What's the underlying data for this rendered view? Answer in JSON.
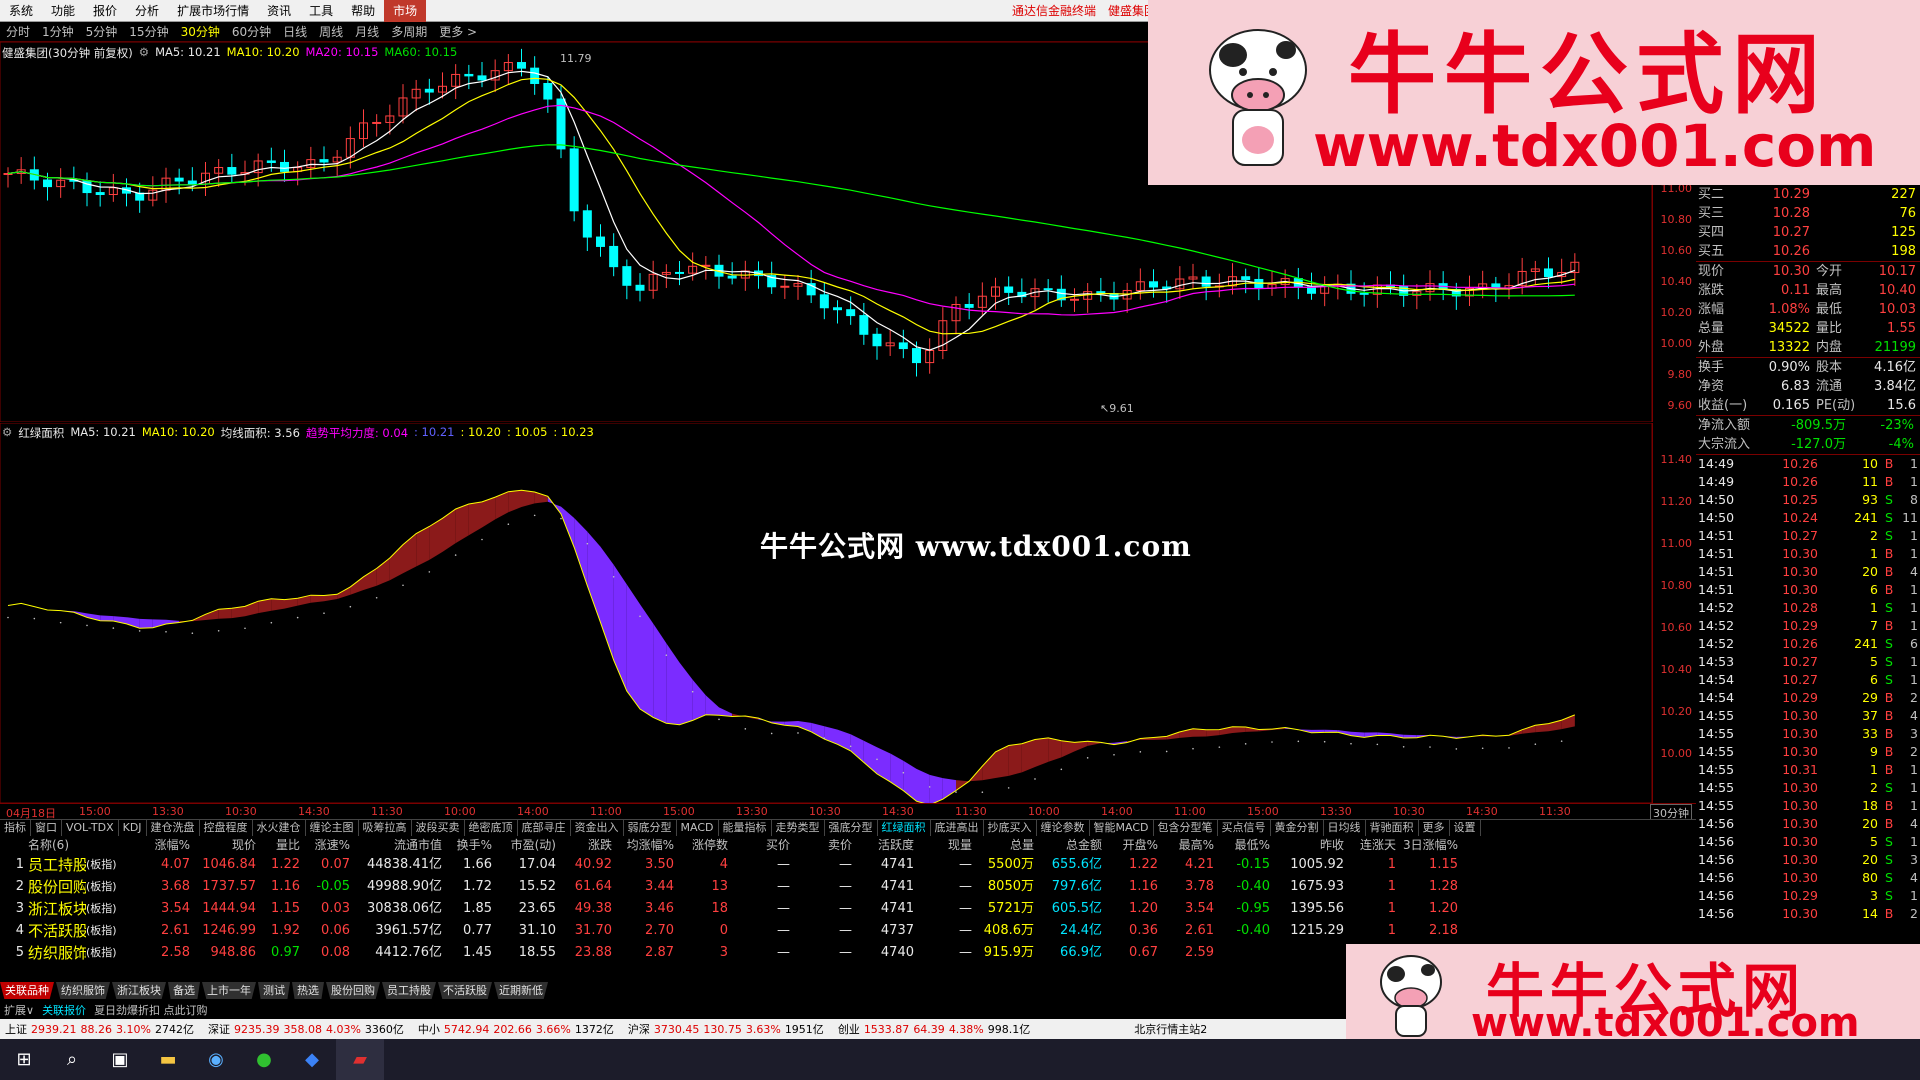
{
  "menu": [
    "系统",
    "功能",
    "报价",
    "分析",
    "扩展市场行情",
    "资讯",
    "工具",
    "帮助",
    "市场"
  ],
  "menu_links": [
    "通达信金融终端",
    "健盛集团"
  ],
  "periods": [
    "分时",
    "1分钟",
    "5分钟",
    "15分钟",
    "30分钟",
    "60分钟",
    "日线",
    "周线",
    "月线",
    "多周期",
    "更多 >"
  ],
  "legend_main": {
    "name": "健盛集团(30分钟 前复权)",
    "ma5": "MA5: 10.21",
    "ma10": "MA10: 10.20",
    "ma20": "MA20: 10.15",
    "ma60": "MA60: 10.15"
  },
  "legend_sub": {
    "name": "红绿面积",
    "ma5": "MA5: 10.21",
    "ma10": "MA10: 10.20",
    "jx": "均线面积: 3.56",
    "qs": "趋势平均力度: 0.04",
    "v1": ": 10.21",
    "v2": ": 10.20",
    "v3": ": 10.05",
    "v4": ": 10.23"
  },
  "price_annotations": {
    "high": "11.79",
    "low": "9.61"
  },
  "yaxis_main": [
    "11.00",
    "10.80",
    "10.60",
    "10.40",
    "10.20",
    "10.00",
    "9.80",
    "9.60"
  ],
  "yaxis_sub": [
    "11.40",
    "11.20",
    "11.00",
    "10.80",
    "10.60",
    "10.40",
    "10.20",
    "10.00"
  ],
  "time_labels": [
    "04月18日",
    "15:00",
    "13:30",
    "10:30",
    "14:30",
    "11:30",
    "10:00",
    "14:00",
    "11:00",
    "15:00",
    "13:30",
    "10:30",
    "14:30",
    "11:30",
    "10:00",
    "14:00",
    "11:00",
    "15:00",
    "13:30",
    "10:30",
    "14:30",
    "11:30"
  ],
  "time_select": "30分钟",
  "indicator_tabs": [
    "指标",
    "窗口",
    "VOL-TDX",
    "KDJ",
    "建仓洗盘",
    "控盘程度",
    "水火建仓",
    "缠论主图",
    "吸筹拉高",
    "波段买卖",
    "绝密底顶",
    "底部寻庄",
    "资金出入",
    "弱底分型",
    "MACD",
    "能量指标",
    "走势类型",
    "强底分型",
    "红绿面积",
    "底进高出",
    "抄底买入",
    "缠论参数",
    "智能MACD",
    "包含分型笔",
    "买点信号",
    "黄金分割",
    "日均线",
    "背驰面积",
    "更多",
    "设置"
  ],
  "selected_indicator": "红绿面积",
  "table": {
    "headers": [
      "",
      "名称(6)",
      "",
      "涨幅%",
      "现价",
      "量比",
      "涨速%",
      "流通市值",
      "换手%",
      "市盈(动)",
      "涨跌",
      "均涨幅%",
      "涨停数",
      "买价",
      "卖价",
      "活跃度",
      "现量",
      "总量",
      "总金额",
      "开盘%",
      "最高%",
      "最低%",
      "昨收",
      "连涨天",
      "3日涨幅%"
    ],
    "rows": [
      [
        "1",
        "员工持股",
        "(板指)",
        "4.07",
        "1046.84",
        "1.22",
        "0.07",
        "44838.41亿",
        "1.66",
        "17.04",
        "40.92",
        "3.50",
        "4",
        "—",
        "—",
        "4741",
        "—",
        "5500万",
        "655.6亿",
        "1.22",
        "4.21",
        "-0.15",
        "1005.92",
        "1",
        "1.15"
      ],
      [
        "2",
        "股份回购",
        "(板指)",
        "3.68",
        "1737.57",
        "1.16",
        "-0.05",
        "49988.90亿",
        "1.72",
        "15.52",
        "61.64",
        "3.44",
        "13",
        "—",
        "—",
        "4741",
        "—",
        "8050万",
        "797.6亿",
        "1.16",
        "3.78",
        "-0.40",
        "1675.93",
        "1",
        "1.28"
      ],
      [
        "3",
        "浙江板块",
        "(板指)",
        "3.54",
        "1444.94",
        "1.15",
        "0.03",
        "30838.06亿",
        "1.85",
        "23.65",
        "49.38",
        "3.46",
        "18",
        "—",
        "—",
        "4741",
        "—",
        "5721万",
        "605.5亿",
        "1.20",
        "3.54",
        "-0.95",
        "1395.56",
        "1",
        "1.20"
      ],
      [
        "4",
        "不活跃股",
        "(板指)",
        "2.61",
        "1246.99",
        "1.92",
        "0.06",
        "3961.57亿",
        "0.77",
        "31.10",
        "31.70",
        "2.70",
        "0",
        "—",
        "—",
        "4737",
        "—",
        "408.6万",
        "24.4亿",
        "0.36",
        "2.61",
        "-0.40",
        "1215.29",
        "1",
        "2.18"
      ],
      [
        "5",
        "纺织服饰",
        "(板指)",
        "2.58",
        "948.86",
        "0.97",
        "0.08",
        "4412.76亿",
        "1.45",
        "18.55",
        "23.88",
        "2.87",
        "3",
        "—",
        "—",
        "4740",
        "—",
        "915.9万",
        "66.9亿",
        "0.67",
        "2.59",
        "",
        "",
        "",
        ""
      ]
    ]
  },
  "block_tabs": [
    "关联品种",
    "纺织服饰",
    "浙江板块",
    "备选",
    "上市一年",
    "测试",
    "热选",
    "股份回购",
    "员工持股",
    "不活跃股",
    "近期新低"
  ],
  "ext_bar": [
    "扩展∨",
    "关联报价",
    "夏日劲爆折扣 点此订购"
  ],
  "status": [
    {
      "label": "上证",
      "v": "2939.21",
      "c": "88.26",
      "p": "3.10%",
      "a": "2742亿"
    },
    {
      "label": "深证",
      "v": "9235.39",
      "c": "358.08",
      "p": "4.03%",
      "a": "3360亿"
    },
    {
      "label": "中小",
      "v": "5742.94",
      "c": "202.66",
      "p": "3.66%",
      "a": "1372亿"
    },
    {
      "label": "沪深",
      "v": "3730.45",
      "c": "130.75",
      "p": "3.63%",
      "a": "1951亿"
    },
    {
      "label": "创业",
      "v": "1533.87",
      "c": "64.39",
      "p": "4.38%",
      "a": "998.1亿"
    }
  ],
  "status_right": "北京行情主站2",
  "quote": {
    "bids": [
      [
        "买二",
        "10.29",
        "227"
      ],
      [
        "买三",
        "10.28",
        "76"
      ],
      [
        "买四",
        "10.27",
        "125"
      ],
      [
        "买五",
        "10.26",
        "198"
      ]
    ],
    "stats": [
      [
        "现价",
        "10.30",
        "今开",
        "10.17"
      ],
      [
        "涨跌",
        "0.11",
        "最高",
        "10.40"
      ],
      [
        "涨幅",
        "1.08%",
        "最低",
        "10.03"
      ],
      [
        "总量",
        "34522",
        "量比",
        "1.55"
      ],
      [
        "外盘",
        "13322",
        "内盘",
        "21199"
      ],
      [
        "换手",
        "0.90%",
        "股本",
        "4.16亿"
      ],
      [
        "净资",
        "6.83",
        "流通",
        "3.84亿"
      ],
      [
        "收益(一)",
        "0.165",
        "PE(动)",
        "15.6"
      ]
    ],
    "flows": [
      [
        "净流入额",
        "-809.5万",
        "-23%"
      ],
      [
        "大宗流入",
        "-127.0万",
        "-4%"
      ]
    ]
  },
  "ticks": [
    [
      "14:49",
      "10.26",
      "10",
      "B",
      "1"
    ],
    [
      "14:49",
      "10.26",
      "11",
      "B",
      "1"
    ],
    [
      "14:50",
      "10.25",
      "93",
      "S",
      "8"
    ],
    [
      "14:50",
      "10.24",
      "241",
      "S",
      "11"
    ],
    [
      "14:51",
      "10.27",
      "2",
      "S",
      "1"
    ],
    [
      "14:51",
      "10.30",
      "1",
      "B",
      "1"
    ],
    [
      "14:51",
      "10.30",
      "20",
      "B",
      "4"
    ],
    [
      "14:51",
      "10.30",
      "6",
      "B",
      "1"
    ],
    [
      "14:52",
      "10.28",
      "1",
      "S",
      "1"
    ],
    [
      "14:52",
      "10.29",
      "7",
      "B",
      "1"
    ],
    [
      "14:52",
      "10.26",
      "241",
      "S",
      "6"
    ],
    [
      "14:53",
      "10.27",
      "5",
      "S",
      "1"
    ],
    [
      "14:54",
      "10.27",
      "6",
      "S",
      "1"
    ],
    [
      "14:54",
      "10.29",
      "29",
      "B",
      "2"
    ],
    [
      "14:55",
      "10.30",
      "37",
      "B",
      "4"
    ],
    [
      "14:55",
      "10.30",
      "33",
      "B",
      "3"
    ],
    [
      "14:55",
      "10.30",
      "9",
      "B",
      "2"
    ],
    [
      "14:55",
      "10.31",
      "1",
      "B",
      "1"
    ],
    [
      "14:55",
      "10.30",
      "2",
      "S",
      "1"
    ],
    [
      "14:55",
      "10.30",
      "18",
      "B",
      "1"
    ],
    [
      "14:56",
      "10.30",
      "20",
      "B",
      "4"
    ],
    [
      "14:56",
      "10.30",
      "5",
      "S",
      "1"
    ],
    [
      "14:56",
      "10.30",
      "20",
      "S",
      "3"
    ],
    [
      "14:56",
      "10.30",
      "80",
      "S",
      "4"
    ],
    [
      "14:56",
      "10.29",
      "3",
      "S",
      "1"
    ],
    [
      "14:56",
      "10.30",
      "14",
      "B",
      "2"
    ]
  ],
  "ad": {
    "title": "牛牛公式网",
    "url": "www.tdx001.com"
  },
  "watermark": "牛牛公式网  www.tdx001.com",
  "colors": {
    "up": "#ff4040",
    "down": "#00ffff",
    "ma5": "#ffffff",
    "ma10": "#ffff00",
    "ma20": "#ff00ff",
    "ma60": "#00ff00",
    "area_red": "#8b1a1a",
    "area_blue": "#7b2cff"
  }
}
